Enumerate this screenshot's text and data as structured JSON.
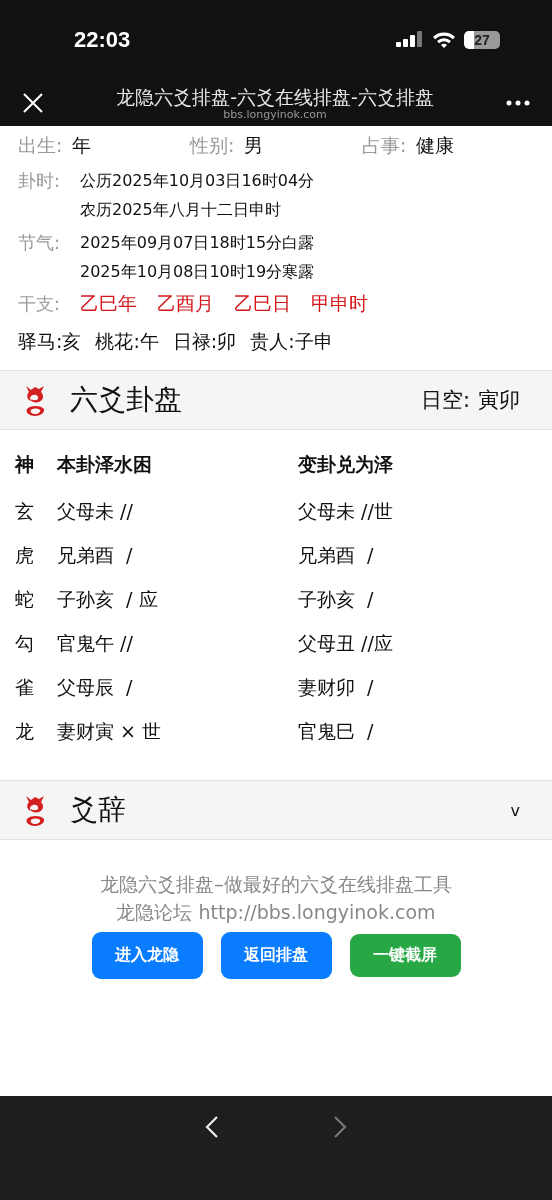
{
  "status_bar": {
    "time": "22:03",
    "battery": "27"
  },
  "nav": {
    "title": "龙隐六爻排盘-六爻在线排盘-六爻排盘",
    "url": "bbs.longyinok.com"
  },
  "info": {
    "basics": [
      {
        "label": "出生:",
        "value": "年"
      },
      {
        "label": "性别:",
        "value": "男"
      },
      {
        "label": "占事:",
        "value": "健康"
      }
    ],
    "gua_time": {
      "label": "卦时:",
      "lines": [
        "公历2025年10月03日16时04分",
        "农历2025年八月十二日申时"
      ]
    },
    "solar_terms": {
      "label": "节气:",
      "lines": [
        "2025年09月07日18时15分白露",
        "2025年10月08日10时19分寒露"
      ]
    },
    "ganzhi": {
      "label": "干支:",
      "items": [
        "乙巳年",
        "乙酉月",
        "乙巳日",
        "甲申时"
      ]
    },
    "shensha": [
      "驿马:亥",
      "桃花:午",
      "日禄:卯",
      "贵人:子申"
    ]
  },
  "hexagram": {
    "title": "六爻卦盘",
    "void_label": "日空:",
    "void_value": "寅卯",
    "columns": [
      "神",
      "本卦泽水困",
      "变卦兑为泽"
    ],
    "rows": [
      {
        "god": "玄",
        "main": "父母未 //",
        "changed": "父母未 //世"
      },
      {
        "god": "虎",
        "main": "兄弟酉  /",
        "changed": "兄弟酉  /"
      },
      {
        "god": "蛇",
        "main": "子孙亥  / 应",
        "changed": "子孙亥  /"
      },
      {
        "god": "勾",
        "main": "官鬼午 //",
        "changed": "父母丑 //应"
      },
      {
        "god": "雀",
        "main": "父母辰  /",
        "changed": "妻财卯  /"
      },
      {
        "god": "龙",
        "main": "妻财寅 × 世",
        "changed": "官鬼巳  /"
      }
    ]
  },
  "yao_ci": {
    "title": "爻辞",
    "expanded": false,
    "toggle": "v"
  },
  "footer": {
    "lines": [
      "龙隐六爻排盘–做最好的六爻在线排盘工具",
      "龙隐论坛 http://bbs.longyinok.com"
    ],
    "buttons": [
      {
        "label": "进入龙隐",
        "kind": "primary"
      },
      {
        "label": "返回排盘",
        "kind": "primary"
      },
      {
        "label": "一键截屏",
        "kind": "success"
      }
    ]
  },
  "browser_bar": {
    "back": {
      "disabled": false
    },
    "forward": {
      "disabled": true
    }
  }
}
